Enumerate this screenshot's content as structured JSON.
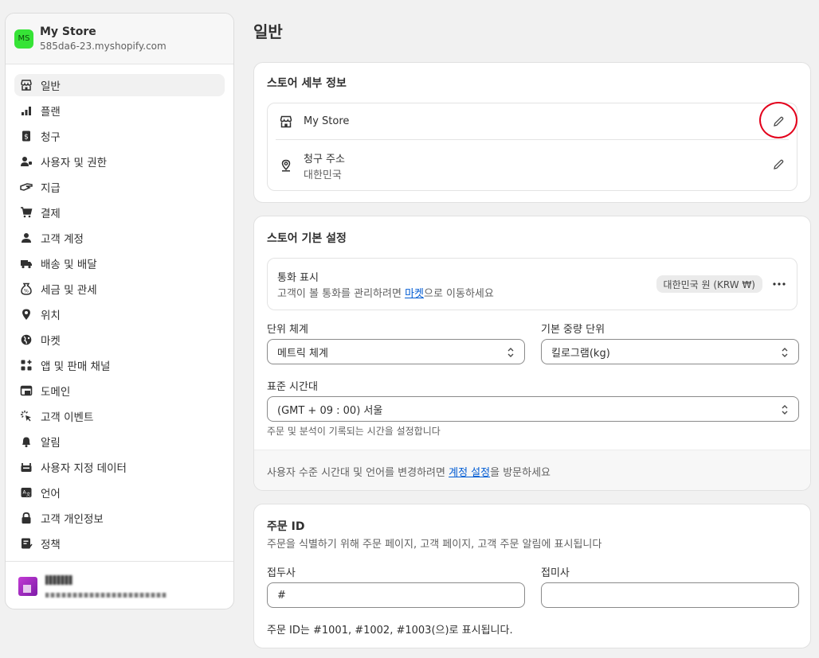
{
  "store": {
    "initials": "MS",
    "name": "My Store",
    "url": "585da6-23.myshopify.com",
    "avatar_color": "#36e336"
  },
  "sidebar": {
    "items": [
      {
        "label": "일반",
        "icon": "store-icon",
        "active": true
      },
      {
        "label": "플랜",
        "icon": "plan-icon"
      },
      {
        "label": "청구",
        "icon": "billing-icon"
      },
      {
        "label": "사용자 및 권한",
        "icon": "users-icon"
      },
      {
        "label": "지급",
        "icon": "payments-icon"
      },
      {
        "label": "결제",
        "icon": "cart-icon"
      },
      {
        "label": "고객 계정",
        "icon": "person-icon"
      },
      {
        "label": "배송 및 배달",
        "icon": "truck-icon"
      },
      {
        "label": "세금 및 관세",
        "icon": "tax-icon"
      },
      {
        "label": "위치",
        "icon": "location-icon"
      },
      {
        "label": "마켓",
        "icon": "globe-icon"
      },
      {
        "label": "앱 및 판매 채널",
        "icon": "apps-icon"
      },
      {
        "label": "도메인",
        "icon": "domain-icon"
      },
      {
        "label": "고객 이벤트",
        "icon": "cursor-click-icon"
      },
      {
        "label": "알림",
        "icon": "bell-icon"
      },
      {
        "label": "사용자 지정 데이터",
        "icon": "metafields-icon"
      },
      {
        "label": "언어",
        "icon": "language-icon"
      },
      {
        "label": "고객 개인정보",
        "icon": "lock-icon"
      },
      {
        "label": "정책",
        "icon": "policy-icon"
      }
    ]
  },
  "page": {
    "title": "일반"
  },
  "store_details": {
    "title": "스토어 세부 정보",
    "store_name": "My Store",
    "billing_label": "청구 주소",
    "billing_value": "대한민국"
  },
  "store_defaults": {
    "title": "스토어 기본 설정",
    "currency_label": "통화 표시",
    "currency_desc_prefix": "고객이 볼 통화를 관리하려면 ",
    "currency_desc_link": "마켓",
    "currency_desc_suffix": "으로 이동하세요",
    "currency_badge": "대한민국 원 (KRW ₩)",
    "unit_system_label": "단위 체계",
    "unit_system_value": "메트릭 체계",
    "weight_unit_label": "기본 중량 단위",
    "weight_unit_value": "킬로그램(kg)",
    "timezone_label": "표준 시간대",
    "timezone_value": "(GMT + 09 : 00) 서울",
    "timezone_help": "주문 및 분석이 기록되는 시간을 설정합니다",
    "footer_prefix": "사용자 수준 시간대 및 언어를 변경하려면 ",
    "footer_link": "계정 설정",
    "footer_suffix": "을 방문하세요"
  },
  "order_id": {
    "title": "주문 ID",
    "description": "주문을 식별하기 위해 주문 페이지, 고객 페이지, 고객 주문 알림에 표시됩니다",
    "prefix_label": "접두사",
    "prefix_value": "#",
    "suffix_label": "접미사",
    "suffix_value": "",
    "preview": "주문 ID는 #1001, #1002, #1003(으)로 표시됩니다."
  },
  "annotation_color": "#e3001b"
}
